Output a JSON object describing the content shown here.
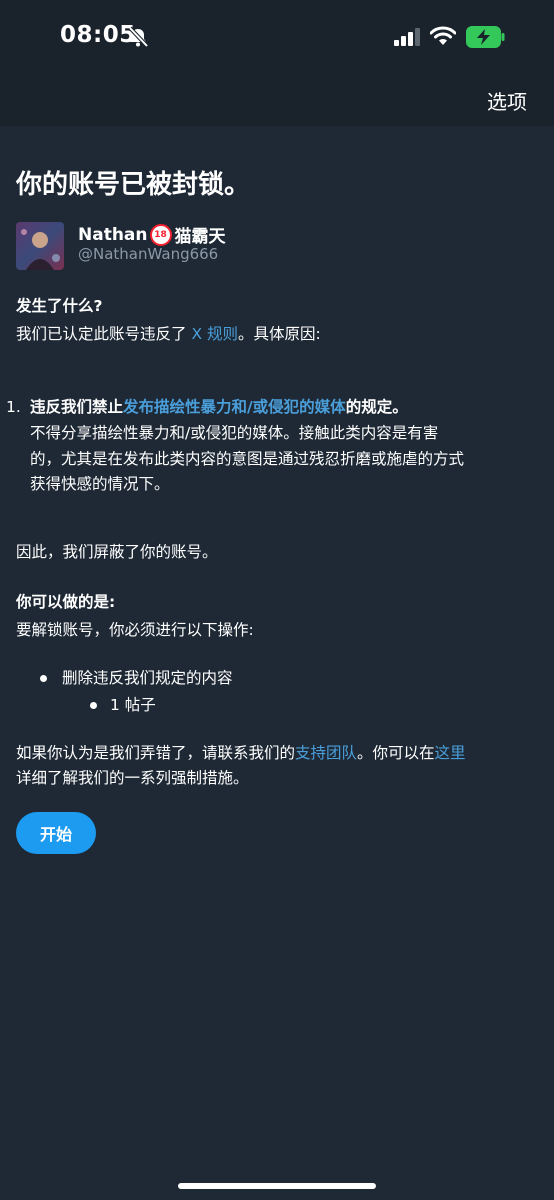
{
  "status_bar": {
    "time": "08:05"
  },
  "header": {
    "options_label": "选项"
  },
  "page": {
    "title": "你的账号已被封锁。",
    "account": {
      "display_name": "Nathan",
      "badge": "18",
      "display_name_suffix": "猫霸天",
      "handle": "@NathanWang666"
    },
    "what_happened": {
      "heading": "发生了什么?",
      "text_before": "我们已认定此账号违反了 ",
      "rules_link": "X 规则",
      "text_after": "。具体原因:"
    },
    "violation": {
      "number": "1.",
      "prefix": "违反我们禁止",
      "policy_link": "发布描绘性暴力和/或侵犯的媒体",
      "suffix": "的规定。",
      "desc_line1": "不得分享描绘性暴力和/或侵犯的媒体。接触此类内容是有害",
      "desc_line2": "的，尤其是在发布此类内容的意图是通过残忍折磨或施虐的方式",
      "desc_line3": "获得快感的情况下。"
    },
    "consequence": "因此，我们屏蔽了你的账号。",
    "what_you_can_do": {
      "heading": "你可以做的是:",
      "text": "要解锁账号，你必须进行以下操作:"
    },
    "actions": {
      "item": "删除违反我们规定的内容",
      "subitem": "1 帖子"
    },
    "appeal": {
      "line1_before": "如果你认为是我们弄错了，请联系我们的",
      "support_link": "支持团队",
      "line1_middle": "。你可以在",
      "here_link": "这里",
      "line2": "详细了解我们的一系列强制措施。"
    },
    "start_button": "开始"
  },
  "colors": {
    "background": "#1e2935",
    "link": "#4a9eda",
    "button": "#1d9bf0"
  },
  "icons": [
    "bell-muted-icon",
    "cellular-signal-icon",
    "wifi-icon",
    "battery-charging-icon"
  ]
}
